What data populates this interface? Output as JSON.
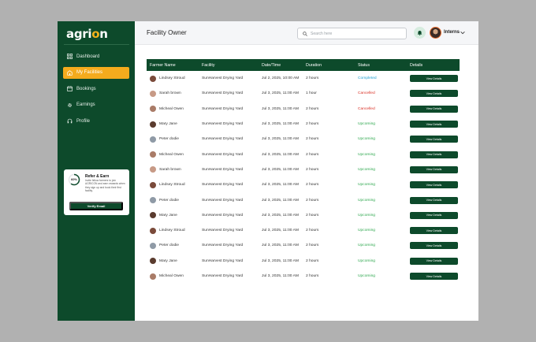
{
  "app": {
    "logo_prefix": "agri",
    "logo_accent": "o",
    "logo_suffix": "n"
  },
  "sidebar": {
    "items": [
      {
        "label": "Dashboard",
        "icon": "grid-icon"
      },
      {
        "label": "My Facilities",
        "icon": "building-icon",
        "active": true
      },
      {
        "label": "Bookings",
        "icon": "calendar-icon"
      },
      {
        "label": "Earnings",
        "icon": "gear-icon"
      },
      {
        "label": "Profile",
        "icon": "headset-icon"
      }
    ]
  },
  "refer": {
    "percent": "60%",
    "progress": 0.6,
    "title": "Refer & Earn",
    "body": "Invite fellow farmers to join AGRICON and earn rewards when they sign up and book their first facility.",
    "button": "Verify Email"
  },
  "header": {
    "title": "Facility Owner",
    "search_placeholder": "Search here",
    "user_name": "Interns"
  },
  "table": {
    "columns": [
      "Farmer Name",
      "Facility",
      "Date/Time",
      "Duration",
      "Status",
      "Details"
    ],
    "button_label": "View Details",
    "rows": [
      {
        "name": "Lindsey Stroud",
        "facility": "SunHarvest Drying Yard",
        "datetime": "Jul 2, 2025, 10:00 AM",
        "duration": "2 hours",
        "status": "Completed",
        "avatar": "#7a4a3a"
      },
      {
        "name": "Sarah brown",
        "facility": "SunHarvest Drying Yard",
        "datetime": "Jul 3, 2025, 11:00 AM",
        "duration": "1 hour",
        "status": "Cancelled",
        "avatar": "#c79a86"
      },
      {
        "name": "Micheal Owen",
        "facility": "SunHarvest Drying Yard",
        "datetime": "Jul 3, 2025, 11:00 AM",
        "duration": "2 hours",
        "status": "Cancelled",
        "avatar": "#a97b67"
      },
      {
        "name": "Mary Jane",
        "facility": "SunHarvest Drying Yard",
        "datetime": "Jul 3, 2025, 11:00 AM",
        "duration": "2 hours",
        "status": "Upcoming",
        "avatar": "#5a3b2e"
      },
      {
        "name": "Peter dodie",
        "facility": "SunHarvest Drying Yard",
        "datetime": "Jul 3, 2025, 11:00 AM",
        "duration": "2 hours",
        "status": "Upcoming",
        "avatar": "#8f9aa6"
      },
      {
        "name": "Micheal Owen",
        "facility": "SunHarvest Drying Yard",
        "datetime": "Jul 3, 2025, 11:00 AM",
        "duration": "2 hours",
        "status": "Upcoming",
        "avatar": "#a97b67"
      },
      {
        "name": "Sarah brown",
        "facility": "SunHarvest Drying Yard",
        "datetime": "Jul 3, 2025, 11:00 AM",
        "duration": "2 hours",
        "status": "Upcoming",
        "avatar": "#c79a86"
      },
      {
        "name": "Lindsey Stroud",
        "facility": "SunHarvest Drying Yard",
        "datetime": "Jul 3, 2025, 11:00 AM",
        "duration": "2 hours",
        "status": "Upcoming",
        "avatar": "#7a4a3a"
      },
      {
        "name": "Peter dodie",
        "facility": "SunHarvest Drying Yard",
        "datetime": "Jul 3, 2025, 11:00 AM",
        "duration": "2 hours",
        "status": "Upcoming",
        "avatar": "#8f9aa6"
      },
      {
        "name": "Mary Jane",
        "facility": "SunHarvest Drying Yard",
        "datetime": "Jul 3, 2025, 11:00 AM",
        "duration": "2 hours",
        "status": "Upcoming",
        "avatar": "#5a3b2e"
      },
      {
        "name": "Lindsey Stroud",
        "facility": "SunHarvest Drying Yard",
        "datetime": "Jul 3, 2025, 11:00 AM",
        "duration": "2 hours",
        "status": "Upcoming",
        "avatar": "#7a4a3a"
      },
      {
        "name": "Peter dodie",
        "facility": "SunHarvest Drying Yard",
        "datetime": "Jul 3, 2025, 11:00 AM",
        "duration": "2 hours",
        "status": "Upcoming",
        "avatar": "#8f9aa6"
      },
      {
        "name": "Mary Jane",
        "facility": "SunHarvest Drying Yard",
        "datetime": "Jul 3, 2025, 11:00 AM",
        "duration": "2 hours",
        "status": "Upcoming",
        "avatar": "#5a3b2e"
      },
      {
        "name": "Micheal Owen",
        "facility": "SunHarvest Drying Yard",
        "datetime": "Jul 3, 2025, 11:00 AM",
        "duration": "2 hours",
        "status": "Upcoming",
        "avatar": "#a97b67"
      }
    ]
  },
  "colors": {
    "brand_green": "#0d4a2b",
    "accent_orange": "#f4ab1d",
    "completed": "#1f9fd1",
    "cancelled": "#d93025",
    "upcoming": "#2fa84f"
  }
}
